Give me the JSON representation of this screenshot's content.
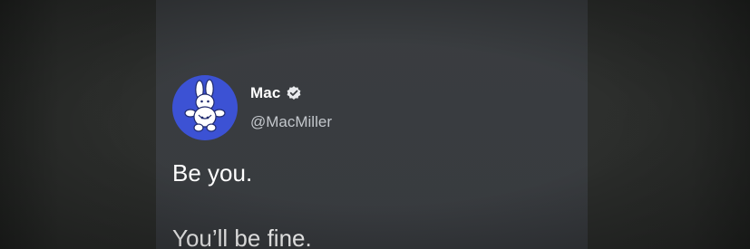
{
  "tweet": {
    "author": {
      "display_name": "Mac",
      "handle": "@MacMiller",
      "verified": true,
      "avatar_icon": "bunny-mascot-icon",
      "avatar_color": "#3c52d4"
    },
    "text_lines": [
      "Be you.",
      "You’ll be fine."
    ]
  },
  "colors": {
    "card_background": "#3a3d40",
    "page_background": "#2b2d2b",
    "primary_text": "#ffffff",
    "secondary_text": "#c3c7cc"
  }
}
